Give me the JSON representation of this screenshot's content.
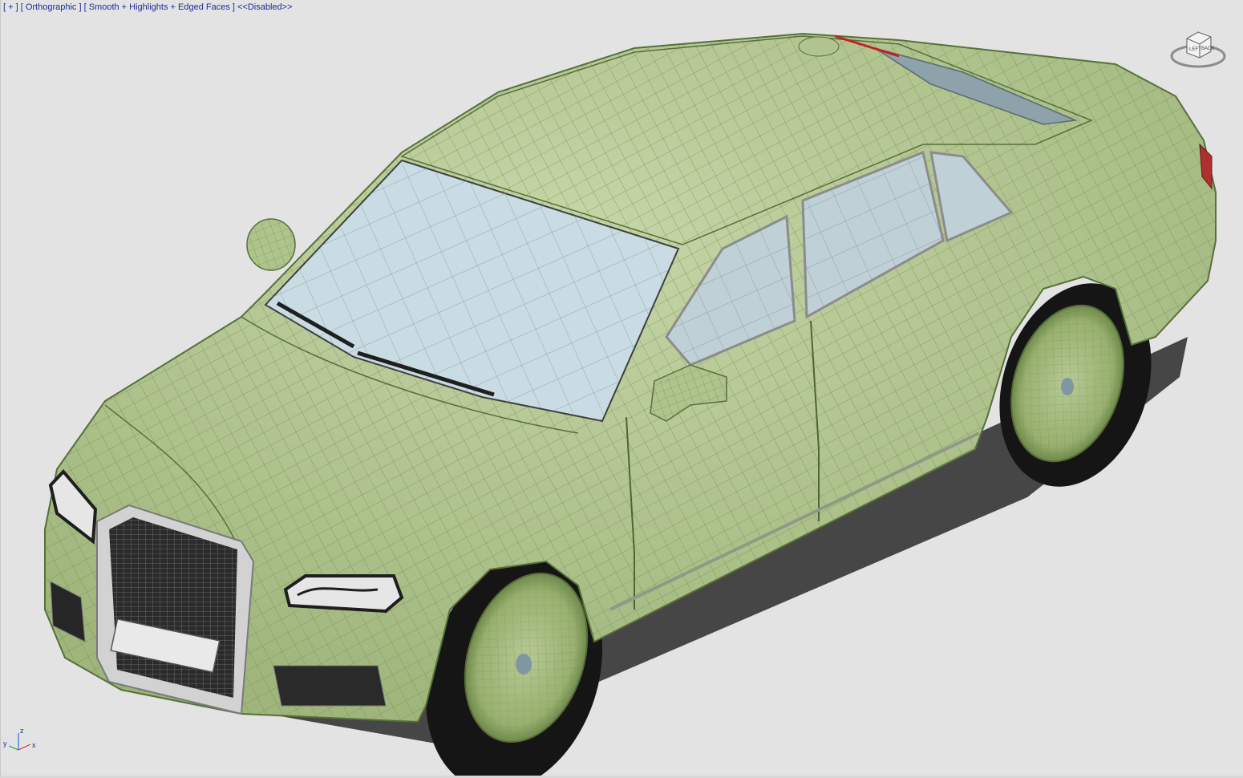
{
  "viewport": {
    "label_plus": "[ + ]",
    "label_view": "[ Orthographic ]",
    "label_shading": "[ Smooth + Highlights + Edged Faces ]",
    "label_disabled": "<<Disabled>>"
  },
  "viewcube": {
    "icon": "viewcube-icon"
  },
  "axis": {
    "x": "x",
    "y": "y",
    "z": "z"
  },
  "colors": {
    "background": "#e3e3e3",
    "body": "#a9bf86",
    "body_light": "#c3d3a3",
    "wire": "#6f8a4c",
    "glass": "#c9dce3",
    "grille": "#2c2c2c",
    "tire": "#161616",
    "label_text": "#1a2b9a"
  }
}
